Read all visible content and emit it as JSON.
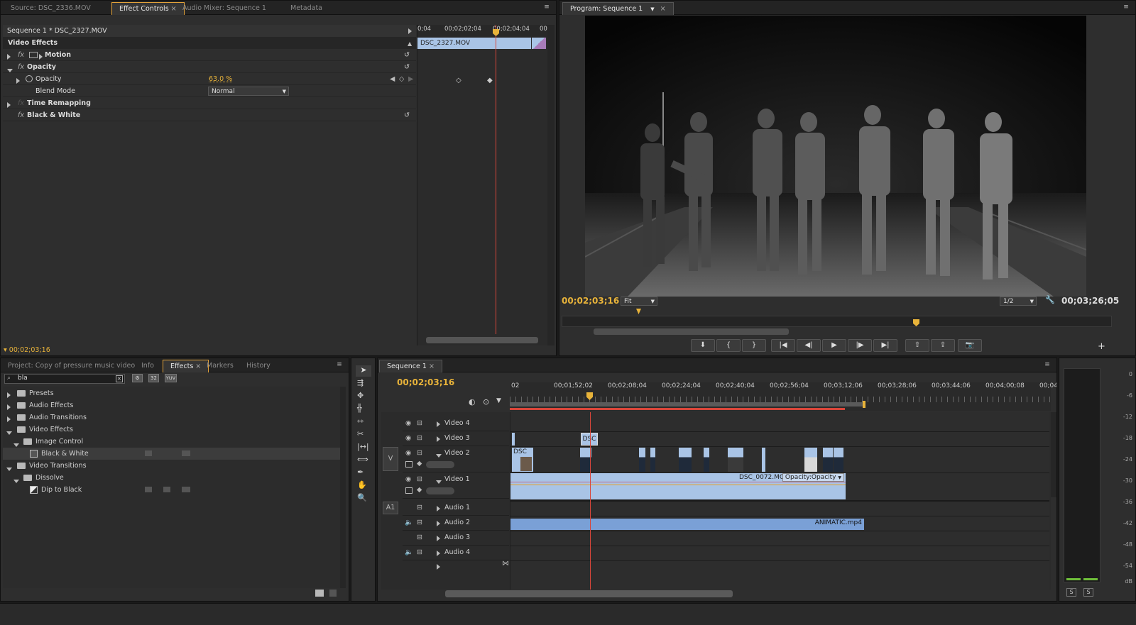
{
  "source_panel": {
    "tabs": [
      {
        "label": "Source: DSC_2336.MOV"
      },
      {
        "label": "Effect Controls"
      },
      {
        "label": "Audio Mixer: Sequence 1"
      },
      {
        "label": "Metadata"
      }
    ],
    "active_tab": "Effect Controls"
  },
  "effect_controls": {
    "clip_path": "Sequence 1 * DSC_2327.MOV",
    "section_header": "Video Effects",
    "timeline_ruler": [
      "0;04",
      "00;02;02;04",
      "00;02;04;04",
      "00"
    ],
    "clip_bar_label": "DSC_2327.MOV",
    "effects": [
      {
        "name": "Motion",
        "expanded": false
      },
      {
        "name": "Opacity",
        "expanded": true
      },
      {
        "name": "Time Remapping",
        "expanded": false
      },
      {
        "name": "Black & White",
        "expanded": false
      }
    ],
    "opacity_property": {
      "label": "Opacity",
      "value": "63.0 %"
    },
    "blend_mode": {
      "label": "Blend Mode",
      "value": "Normal"
    },
    "current_time": "00;02;03;16"
  },
  "program_monitor": {
    "tab_label": "Program: Sequence 1",
    "current_time": "00;02;03;16",
    "duration": "00;03;26;05",
    "zoom": "Fit",
    "resolution": "1/2",
    "frame_description": "Black and white multiple-exposure image of a person walking with a guitar across railway tracks at night"
  },
  "project_panel": {
    "tabs": [
      {
        "label": "Project: Copy of pressure music video"
      },
      {
        "label": "Info"
      },
      {
        "label": "Effects"
      },
      {
        "label": "Markers"
      },
      {
        "label": "History"
      }
    ],
    "active_tab": "Effects",
    "search_value": "bla",
    "tree": [
      {
        "label": "Presets",
        "level": 0,
        "expanded": false
      },
      {
        "label": "Audio Effects",
        "level": 0,
        "expanded": false
      },
      {
        "label": "Audio Transitions",
        "level": 0,
        "expanded": false
      },
      {
        "label": "Video Effects",
        "level": 0,
        "expanded": true
      },
      {
        "label": "Image Control",
        "level": 1,
        "expanded": true
      },
      {
        "label": "Black & White",
        "level": 2,
        "effect": true,
        "selected": true
      },
      {
        "label": "Video Transitions",
        "level": 0,
        "expanded": true
      },
      {
        "label": "Dissolve",
        "level": 1,
        "expanded": true
      },
      {
        "label": "Dip to Black",
        "level": 2,
        "effect": true
      }
    ],
    "badges": [
      "32",
      "YUV"
    ]
  },
  "sequence": {
    "tab_label": "Sequence 1",
    "current_time": "00;02;03;16",
    "ruler_labels": [
      "02",
      "00;01;52;02",
      "00;02;08;04",
      "00;02;24;04",
      "00;02;40;04",
      "00;02;56;04",
      "00;03;12;06",
      "00;03;28;06",
      "00;03;44;06",
      "00;04;00;08",
      "00;04;16;08"
    ],
    "video_tracks": [
      "Video 4",
      "Video 3",
      "Video 2",
      "Video 1"
    ],
    "audio_tracks": [
      "Audio 1",
      "Audio 2",
      "Audio 3",
      "Audio 4"
    ],
    "target_video": "V",
    "target_audio": "A1",
    "clips": {
      "video3": "DSC",
      "video2_first": "DSC",
      "video1": "DSC_0072.MOV",
      "video1_fx": "Opacity:Opacity",
      "audio2": "ANIMATIC.mp4"
    }
  },
  "audio_meter": {
    "ticks": [
      "0",
      "-6",
      "-12",
      "-18",
      "-24",
      "-30",
      "-36",
      "-42",
      "-48",
      "-54",
      "dB"
    ],
    "solo_buttons": [
      "S",
      "S"
    ]
  },
  "colors": {
    "accent_yellow": "#e8b33a",
    "playhead_red": "#d9463a",
    "clip_blue": "#a9c4e6",
    "audio_clip_blue": "#7aa0d6"
  }
}
